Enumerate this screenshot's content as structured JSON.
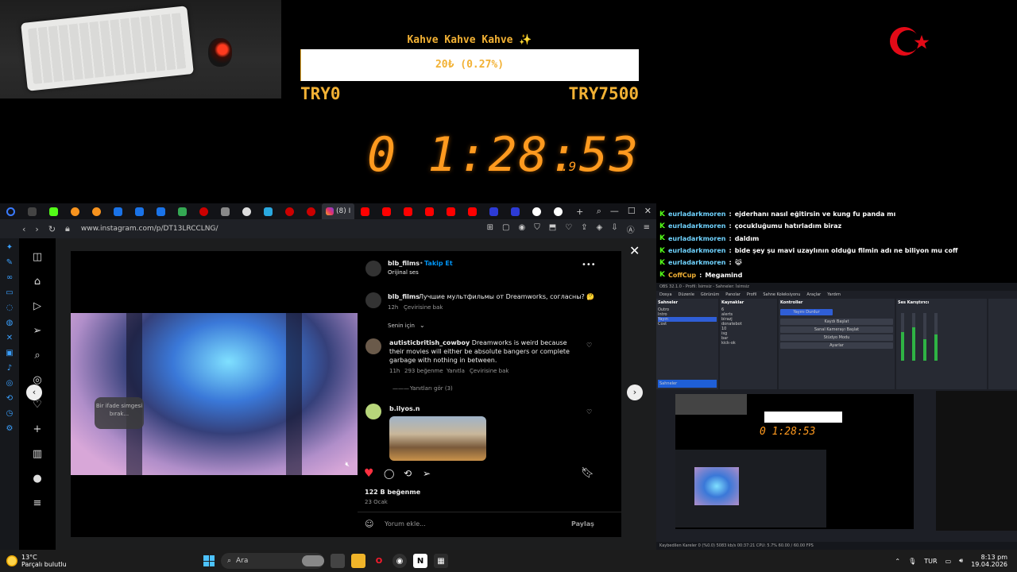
{
  "overlay": {
    "goal_title": "Kahve Kahve Kahve ✨",
    "goal_progress_text": "20₺ (0.27%)",
    "goal_progress_percent": 0.27,
    "goal_min": "TRY0",
    "goal_max": "TRY7500",
    "timer": "0 1:28:53",
    "timer_ms": ".9",
    "colors": {
      "goal": "#f2b134",
      "timer": "#ff9a1f"
    }
  },
  "browser": {
    "active_tab": "(8) I",
    "url": "www.instagram.com/p/DT13LRCCLNG/"
  },
  "post": {
    "author": "blb_films",
    "follow_label": "Takip Et",
    "audio": "Orijinal ses",
    "caption_user": "blb_films",
    "caption": "Лучшие мультфильмы от Dreamworks, согласны? 🤔",
    "caption_time": "12h",
    "caption_translate": "Çevirisine bak",
    "for_you": "Senin için",
    "comments": [
      {
        "user": "autisticbritish_cowboy",
        "text": "Dreamworks is weird because their movies will either be absolute bangers or complete garbage with nothing in between.",
        "time": "11h",
        "likes": "293 beğenme",
        "reply": "Yanıtla",
        "translate": "Çevirisine bak",
        "view_replies": "Yanıtları gör (3)"
      },
      {
        "user": "b.ilyos.n"
      }
    ],
    "like_count": "122 B beğenme",
    "date": "23 Ocak",
    "comment_placeholder": "Yorum ekle...",
    "share_label": "Paylaş",
    "emoji_bubble": "Bir ifade simgesi bırak..."
  },
  "chat": [
    {
      "user": "eurladarkmoren",
      "message": "ejderhanı nasıl eğitirsin ve kung fu panda mı"
    },
    {
      "user": "eurladarkmoren",
      "message": "çocukluğumu hatırladım biraz"
    },
    {
      "user": "eurladarkmoren",
      "message": "daldım"
    },
    {
      "user": "eurladarkmoren",
      "message": "bide şey şu mavi uzaylının olduğu filmin adı ne biliyon mu coff"
    },
    {
      "user": "eurladarkmoren",
      "message": "😹"
    },
    {
      "user": "CoffCup",
      "message": "Megamind"
    }
  ],
  "obs": {
    "title": "OBS 32.1.0 - Profil: İsimsiz - Sahneler: İsimsiz",
    "menu": [
      "Dosya",
      "Düzenle",
      "Görünüm",
      "Panolar",
      "Profil",
      "Sahne Koleksiyonu",
      "Araçlar",
      "Yardım"
    ],
    "panels": {
      "scenes_title": "Sahneler",
      "scenes": [
        "Outro",
        "Intro",
        "Yayın",
        "Cost"
      ],
      "sources_title": "Kaynaklar",
      "sources": [
        "6",
        "alerts",
        "birazj",
        "donatebot",
        "10",
        "isg",
        "bar",
        "kick-ok"
      ],
      "controls_title": "Kontroller",
      "controls": [
        "Yayını Durdur",
        "Kaydı Başlat",
        "Sanal Kamerayı Başlat",
        "Stüdyo Modu",
        "Ayarlar"
      ],
      "mixer_title": "Ses Karıştırıcı",
      "tabs": [
        "Sahneler",
        "Sahne Geçişleri"
      ]
    },
    "preview": {
      "timer": "0 1:28:53"
    },
    "status": "Kaybedilen Kareler 0 (%0.0)   5083 kb/s   00:37:21   CPU: 5.7%   60.00 / 60.00 FPS"
  },
  "taskbar": {
    "temperature": "13°C",
    "weather": "Parçalı bulutlu",
    "search": "Ara",
    "language": "TUR",
    "time": "8:13 pm",
    "date": "19.04.2026"
  }
}
